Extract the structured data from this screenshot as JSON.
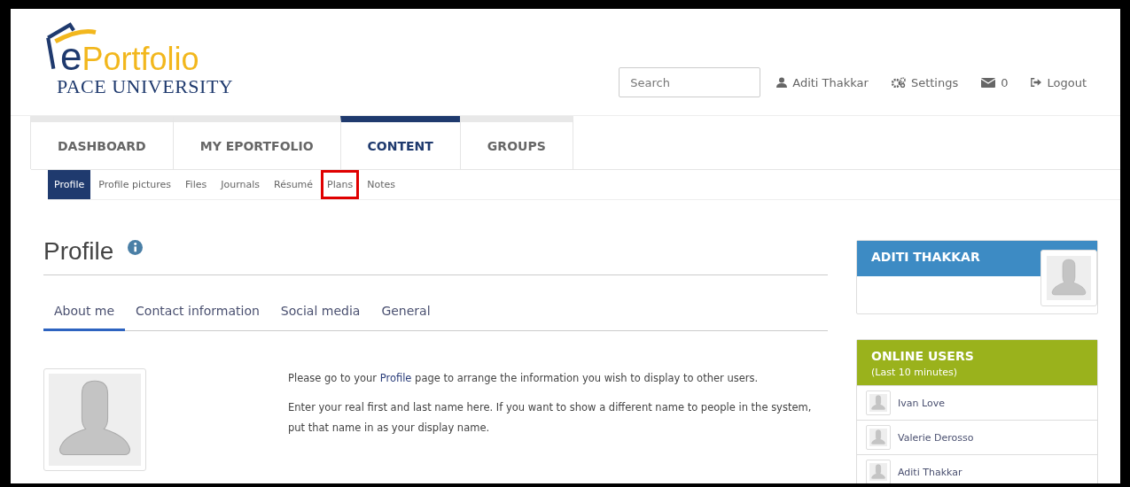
{
  "logo": {
    "initial": "e",
    "word": "Portfolio",
    "subtitle": "PACE UNIVERSITY"
  },
  "header": {
    "search": {
      "placeholder": "Search"
    },
    "links": [
      {
        "kind": "user",
        "label": "Aditi Thakkar"
      },
      {
        "kind": "settings",
        "label": "Settings"
      },
      {
        "kind": "mail",
        "label": "0"
      },
      {
        "kind": "logout",
        "label": "Logout"
      }
    ]
  },
  "main_nav": [
    {
      "label": "DASHBOARD",
      "selected": false
    },
    {
      "label": "MY EPORTFOLIO",
      "selected": false
    },
    {
      "label": "CONTENT",
      "selected": true
    },
    {
      "label": "GROUPS",
      "selected": false
    }
  ],
  "sub_nav": [
    {
      "label": "Profile",
      "selected": true,
      "highlighted": false
    },
    {
      "label": "Profile pictures",
      "selected": false,
      "highlighted": false
    },
    {
      "label": "Files",
      "selected": false,
      "highlighted": false
    },
    {
      "label": "Journals",
      "selected": false,
      "highlighted": false
    },
    {
      "label": "Résumé",
      "selected": false,
      "highlighted": false
    },
    {
      "label": "Plans",
      "selected": false,
      "highlighted": true
    },
    {
      "label": "Notes",
      "selected": false,
      "highlighted": false
    }
  ],
  "page": {
    "title": "Profile",
    "tabs": [
      {
        "label": "About me",
        "selected": true
      },
      {
        "label": "Contact information",
        "selected": false
      },
      {
        "label": "Social media",
        "selected": false
      },
      {
        "label": "General",
        "selected": false
      }
    ],
    "intro": {
      "before": "Please go to your",
      "link": "Profile",
      "after": "page to arrange the information you wish to display to other users."
    },
    "paragraphs": [
      "Enter your real first and last name here. If you want to show a different name to people in the system, put that name in as your display name."
    ]
  },
  "sidebar": {
    "user_card": {
      "title": "ADITI THAKKAR"
    },
    "online_users": {
      "title": "ONLINE USERS",
      "subtitle": "(Last 10 minutes)",
      "users": [
        "Ivan Love",
        "Valerie Derosso",
        "Aditi Thakkar"
      ]
    }
  }
}
